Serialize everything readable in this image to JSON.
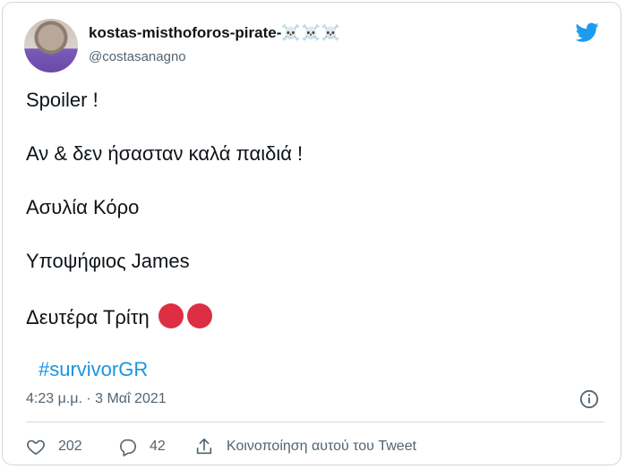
{
  "tweet": {
    "author_name": "kostas-misthoforos-pirate-",
    "author_emoji": "☠️☠️☠️",
    "handle": "@costasanagno",
    "lines": [
      "Spoiler !",
      "Αν & δεν ήσασταν καλά παιδιά !",
      "Ασυλία Κόρο",
      "Υποψήφιος James",
      "Δευτέρα Τρίτη"
    ],
    "line_emoji": "red-circle x2",
    "hashtag": "#survivorGR",
    "timestamp": "4:23 μ.μ. · 3 Μαΐ 2021"
  },
  "actions": {
    "likes": "202",
    "replies": "42",
    "share_label": "Κοινοποίηση αυτού του Tweet"
  },
  "colors": {
    "accent": "#1d9bf0",
    "hashtag": "#1b95e0",
    "muted": "#536471",
    "red": "#dd2e44"
  },
  "icons": [
    "twitter-bird-icon",
    "info-icon",
    "heart-icon",
    "reply-icon",
    "share-icon"
  ]
}
